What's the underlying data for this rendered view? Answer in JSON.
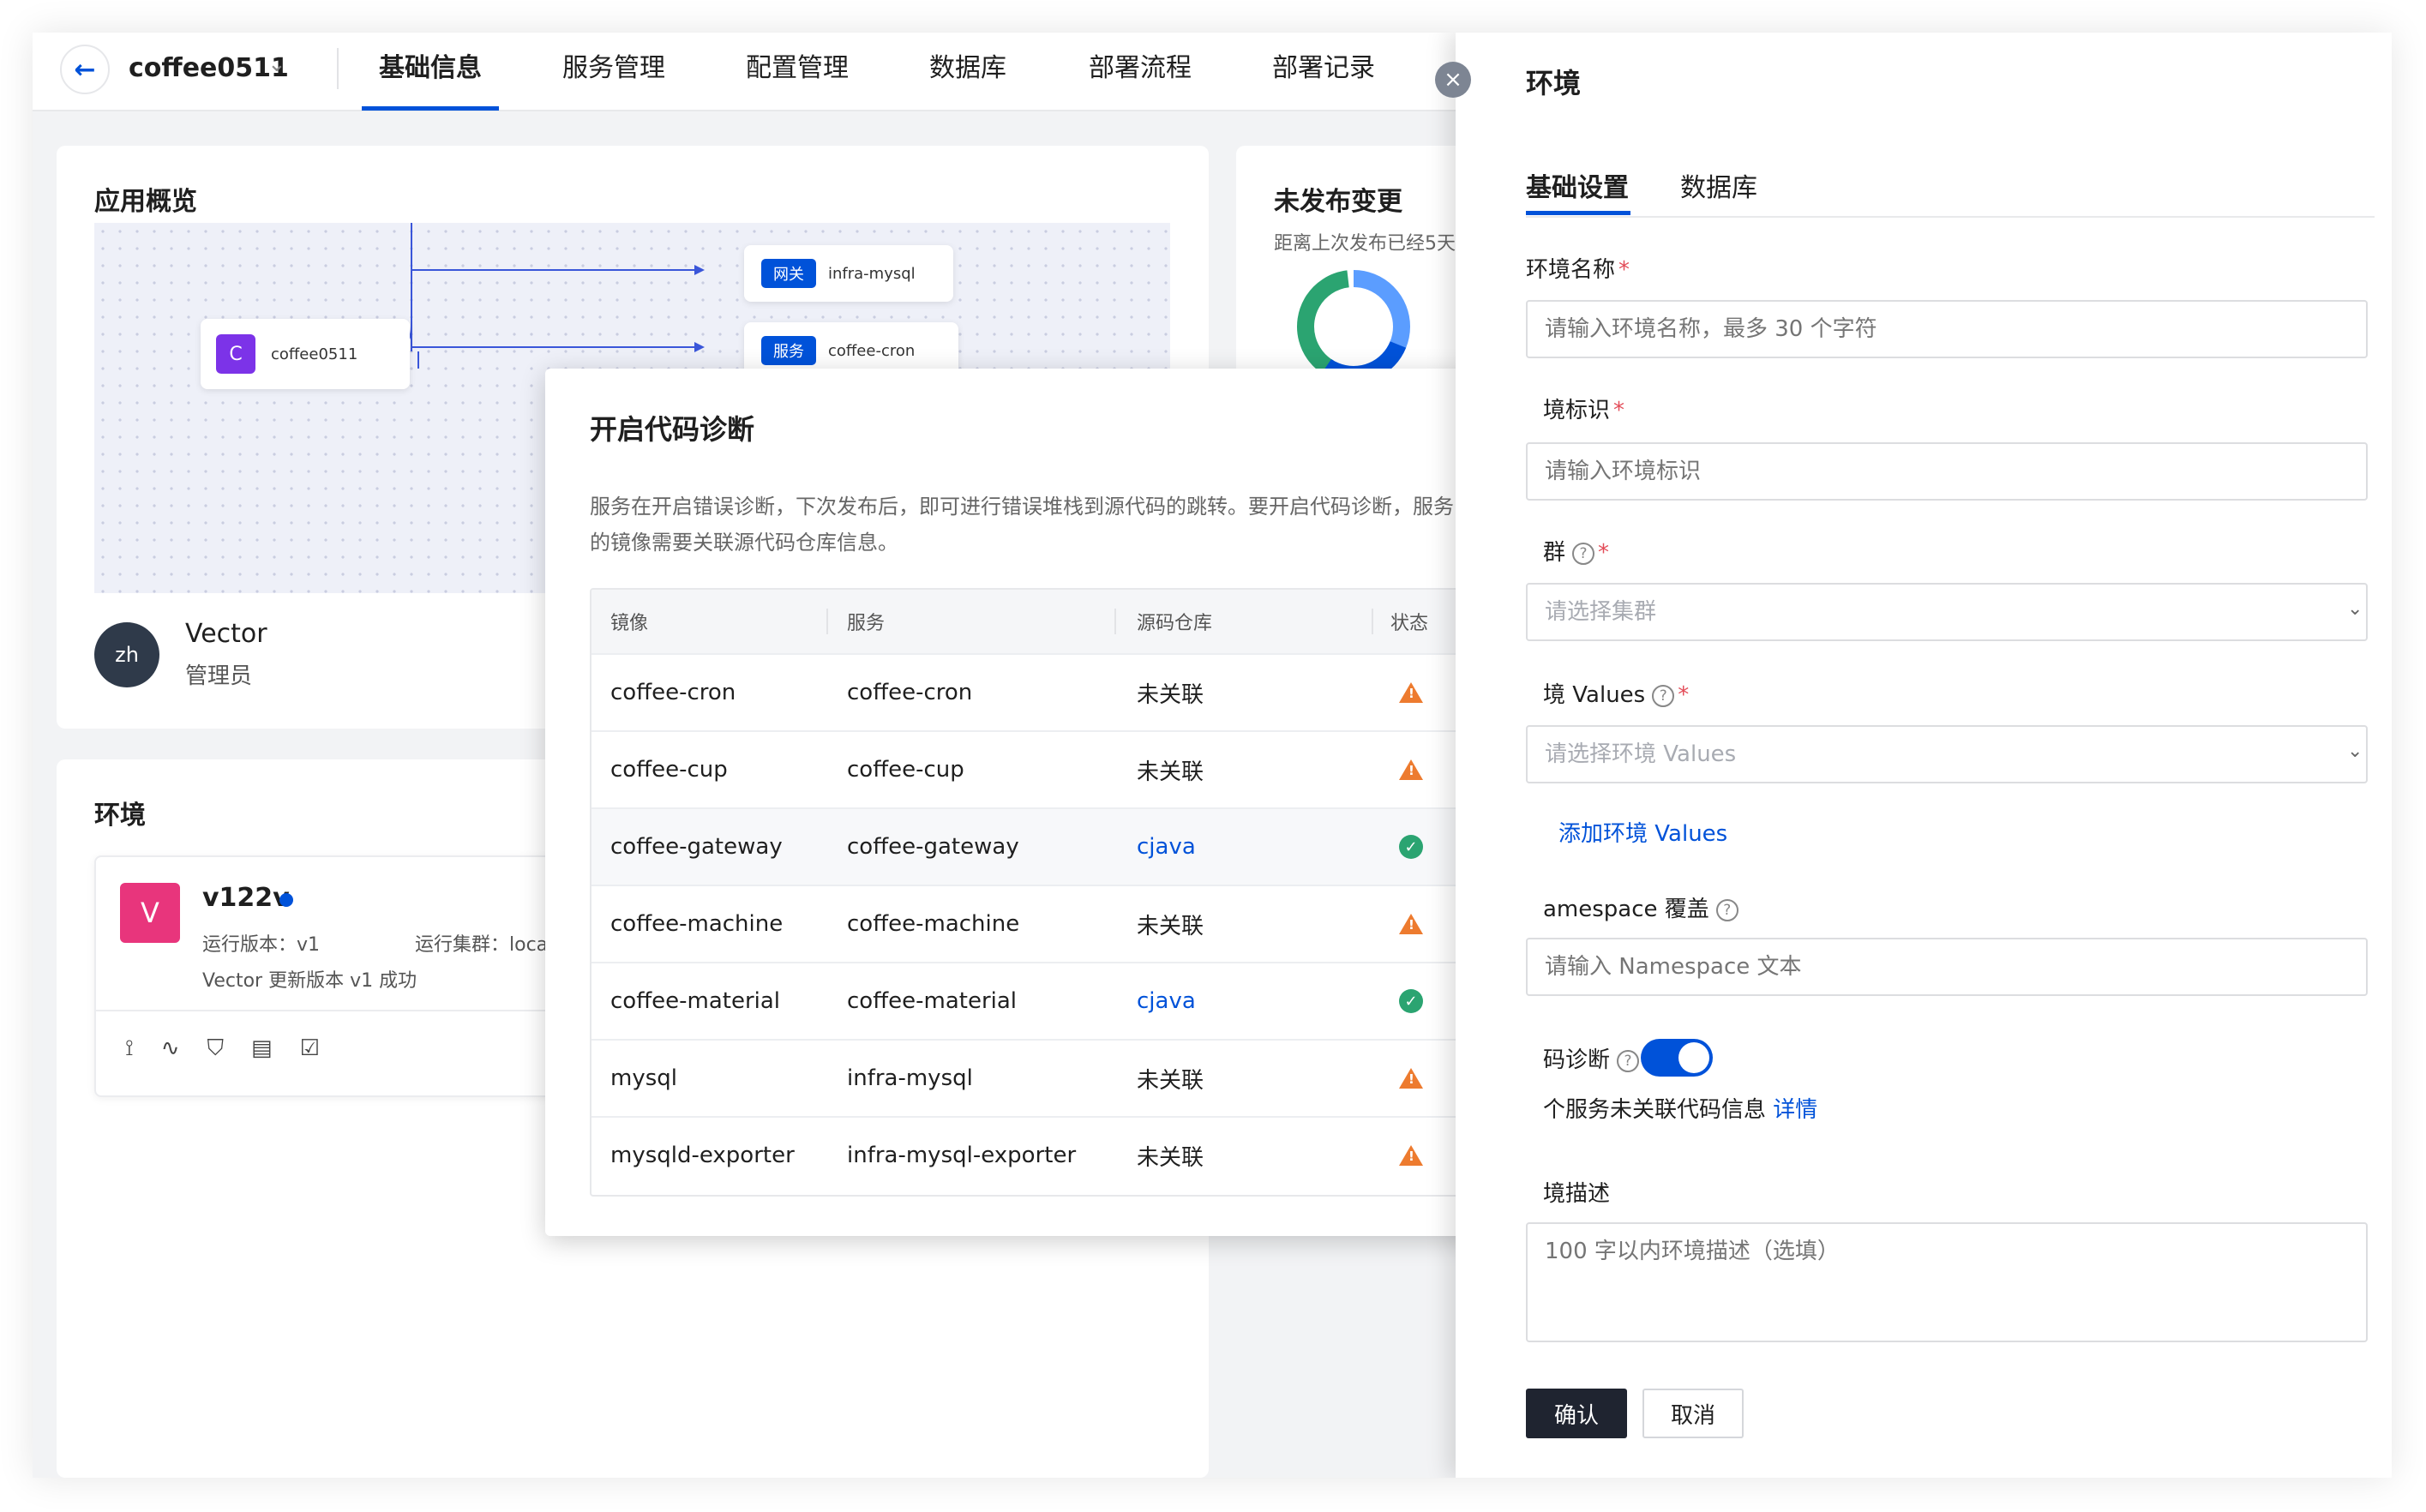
{
  "topnav": {
    "app_name": "coffee0511",
    "tabs": [
      "基础信息",
      "服务管理",
      "配置管理",
      "数据库",
      "部署流程",
      "部署记录"
    ],
    "active_tab": "基础信息"
  },
  "overview": {
    "title": "应用概览",
    "diagram": {
      "root": {
        "badge": "C",
        "name": "coffee0511"
      },
      "nodes": [
        {
          "badge": "网关",
          "name": "infra-mysql"
        },
        {
          "badge": "服务",
          "name": "coffee-cron"
        }
      ]
    },
    "user": {
      "initials": "zh",
      "name": "Vector",
      "role": "管理员"
    }
  },
  "unpublished": {
    "title": "未发布变更",
    "subtitle": "距离上次发布已经5天"
  },
  "env_card": {
    "title": "环境",
    "env": {
      "initial": "V",
      "name": "v122v",
      "run_version": "运行版本：v1",
      "run_cluster": "运行集群：local",
      "message": "Vector 更新版本 v1 成功"
    }
  },
  "modal": {
    "title": "开启代码诊断",
    "description": "服务在开启错误诊断，下次发布后，即可进行错误堆栈到源代码的跳转。要开启代码诊断，服务的镜像需要关联源代码仓库信息。",
    "columns": [
      "镜像",
      "服务",
      "源码仓库",
      "状态"
    ],
    "rows": [
      {
        "image": "coffee-cron",
        "service": "coffee-cron",
        "repo": "未关联",
        "status": "warning"
      },
      {
        "image": "coffee-cup",
        "service": "coffee-cup",
        "repo": "未关联",
        "status": "warning"
      },
      {
        "image": "coffee-gateway",
        "service": "coffee-gateway",
        "repo": "cjava",
        "status": "success"
      },
      {
        "image": "coffee-machine",
        "service": "coffee-machine",
        "repo": "未关联",
        "status": "warning"
      },
      {
        "image": "coffee-material",
        "service": "coffee-material",
        "repo": "cjava",
        "status": "success"
      },
      {
        "image": "mysql",
        "service": "infra-mysql",
        "repo": "未关联",
        "status": "warning"
      },
      {
        "image": "mysqld-exporter",
        "service": "infra-mysql-exporter",
        "repo": "未关联",
        "status": "warning"
      }
    ]
  },
  "drawer": {
    "title": "环境",
    "tabs": [
      "基础设置",
      "数据库"
    ],
    "fields": {
      "env_name": {
        "label": "环境名称",
        "placeholder": "请输入环境名称，最多 30 个字符"
      },
      "env_id": {
        "label": "境标识",
        "placeholder": "请输入环境标识"
      },
      "cluster": {
        "label": "群",
        "placeholder": "请选择集群"
      },
      "values": {
        "label": "境 Values",
        "placeholder": "请选择环境 Values"
      },
      "add_values": "添加环境 Values",
      "namespace": {
        "label": "amespace 覆盖",
        "placeholder": "请输入 Namespace 文本"
      },
      "diagnosis": {
        "label": "码诊断",
        "hint": "个服务未关联代码信息",
        "detail": "详情"
      },
      "description": {
        "label": "境描述",
        "placeholder": "100 字以内环境描述（选填）"
      }
    },
    "confirm": "确认",
    "cancel": "取消"
  },
  "colors": {
    "primary": "#0052d9",
    "warning": "#ed7b2f",
    "success": "#2ba471",
    "required": "#e34d59"
  }
}
